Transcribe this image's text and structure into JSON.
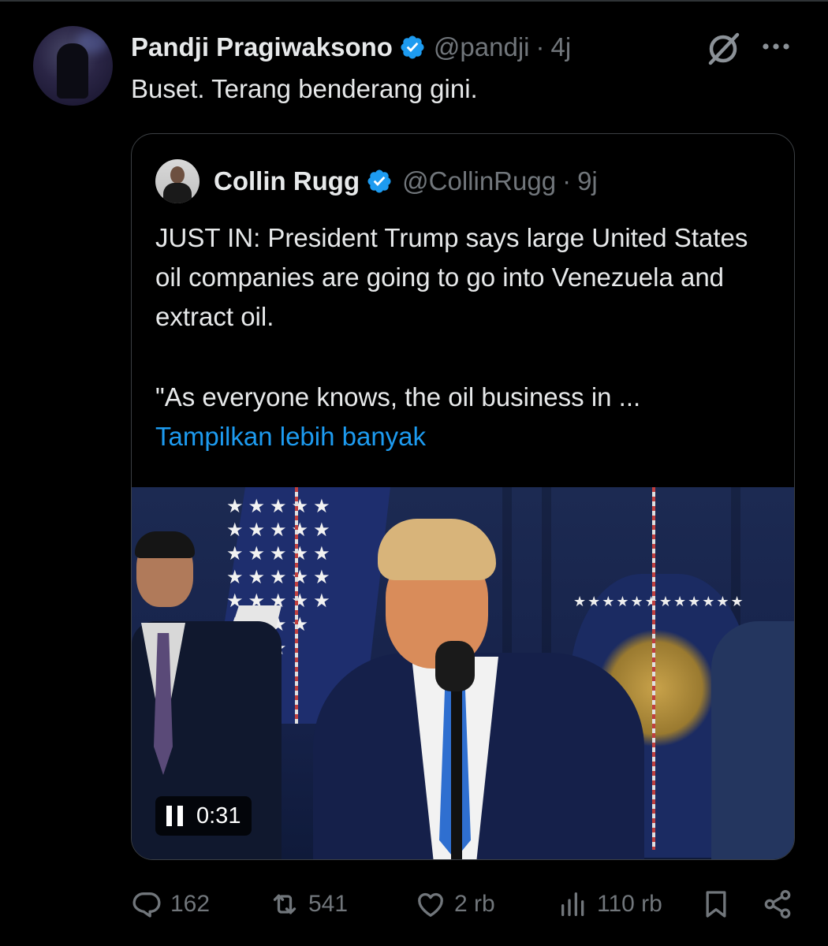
{
  "post": {
    "author_name": "Pandji Pragiwaksono",
    "handle": "@pandji",
    "separator": "·",
    "time": "4j",
    "text": "Buset. Terang benderang gini."
  },
  "quoted": {
    "author_name": "Collin Rugg",
    "handle": "@CollinRugg",
    "separator": "·",
    "time": "9j",
    "paragraph1": "JUST IN: President Trump says large United States oil companies are going to go into Venezuela and extract oil.",
    "paragraph2": "\"As everyone knows, the oil business in ...",
    "show_more": "Tampilkan lebih banyak",
    "video": {
      "state": "playing",
      "duration": "0:31"
    }
  },
  "actions": {
    "replies": "162",
    "reposts": "541",
    "likes": "2 rb",
    "views": "110 rb"
  },
  "colors": {
    "background": "#000000",
    "text": "#e7e9ea",
    "muted": "#71767b",
    "link": "#1d9bf0",
    "verified": "#1d9bf0"
  },
  "icons": [
    "verified-badge-icon",
    "grok-icon",
    "more-icon",
    "pause-icon",
    "reply-icon",
    "repost-icon",
    "like-icon",
    "views-icon",
    "bookmark-icon",
    "share-icon"
  ]
}
